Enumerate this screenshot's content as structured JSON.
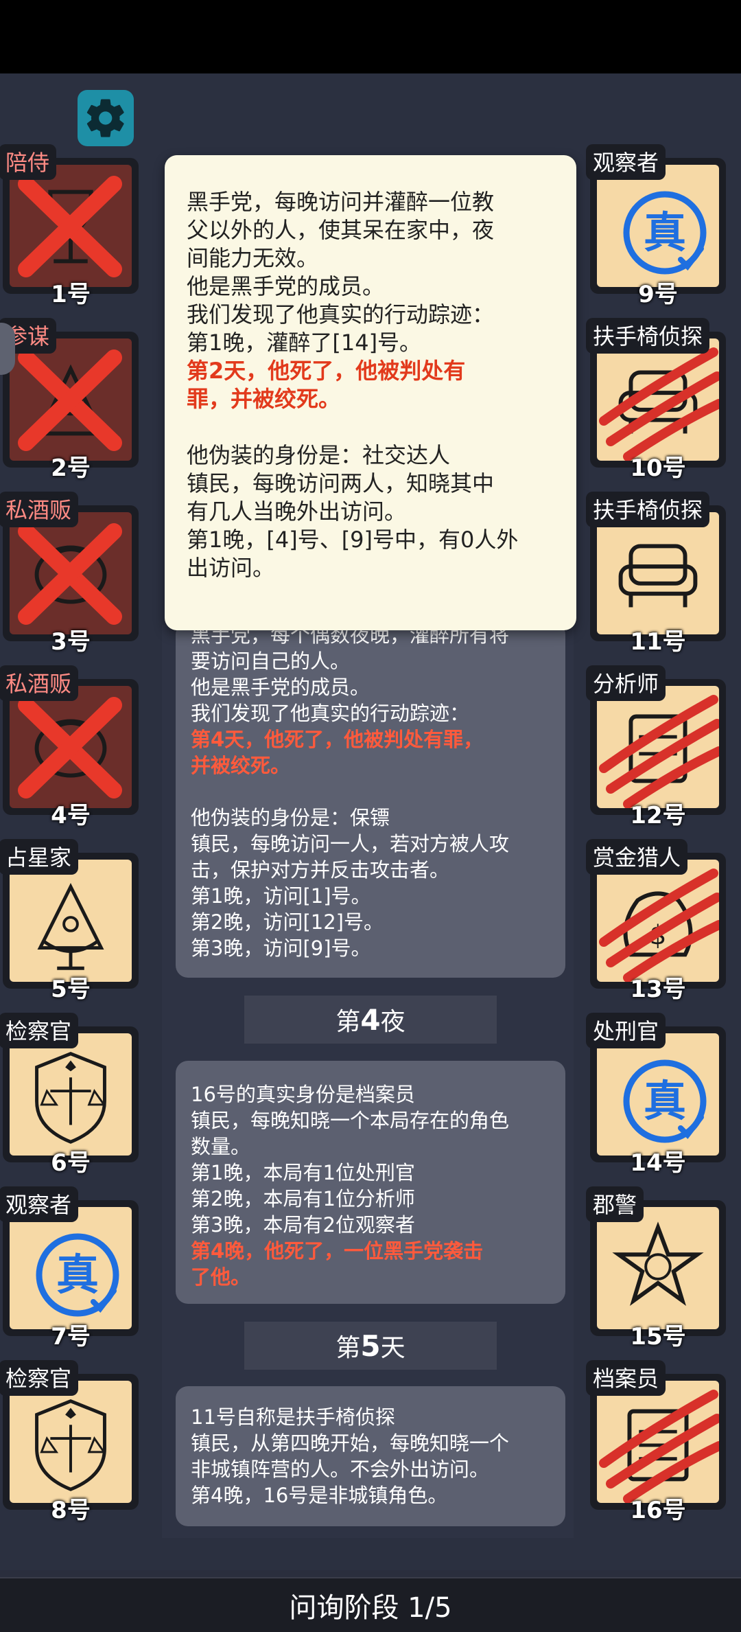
{
  "bottom": {
    "phase_label": "问询阶段 1/5"
  },
  "players_left": [
    {
      "role": "陪侍",
      "num": "1号",
      "state": "dead",
      "icon": "wine-glass-icon"
    },
    {
      "role": "参谋",
      "num": "2号",
      "state": "dead",
      "icon": "consigliere-icon"
    },
    {
      "role": "私酒贩",
      "num": "3号",
      "state": "dead",
      "icon": "bootlegger-icon"
    },
    {
      "role": "私酒贩",
      "num": "4号",
      "state": "dead",
      "icon": "bootlegger-icon"
    },
    {
      "role": "占星家",
      "num": "5号",
      "state": "alive",
      "icon": "sextant-icon"
    },
    {
      "role": "检察官",
      "num": "6号",
      "state": "alive",
      "icon": "justice-scales-icon"
    },
    {
      "role": "观察者",
      "num": "7号",
      "state": "verified",
      "icon": "true-stamp-icon"
    },
    {
      "role": "检察官",
      "num": "8号",
      "state": "alive",
      "icon": "justice-scales-icon"
    }
  ],
  "players_right": [
    {
      "role": "观察者",
      "num": "9号",
      "state": "verified",
      "icon": "true-stamp-icon"
    },
    {
      "role": "扶手椅侦探",
      "num": "10号",
      "state": "clawed",
      "icon": "armchair-icon"
    },
    {
      "role": "扶手椅侦探",
      "num": "11号",
      "state": "alive",
      "icon": "armchair-icon"
    },
    {
      "role": "分析师",
      "num": "12号",
      "state": "clawed",
      "icon": "analyst-icon"
    },
    {
      "role": "赏金猎人",
      "num": "13号",
      "state": "clawed",
      "icon": "money-bag-icon"
    },
    {
      "role": "处刑官",
      "num": "14号",
      "state": "verified",
      "icon": "true-stamp-icon"
    },
    {
      "role": "郡警",
      "num": "15号",
      "state": "alive",
      "icon": "sheriff-star-icon"
    },
    {
      "role": "档案员",
      "num": "16号",
      "state": "clawed",
      "icon": "archive-icon"
    }
  ],
  "popup": {
    "lines": [
      "黑手党，每晚访问并灌醉一位教",
      "父以外的人，使其呆在家中，夜",
      "间能力无效。",
      "他是黑手党的成员。",
      "我们发现了他真实的行动踪迹：",
      "第1晚，灌醉了[14]号。"
    ],
    "red_lines": [
      "第2天，他死了，他被判处有",
      "罪，并被绞死。"
    ],
    "disguise_lines": [
      "他伪装的身份是：社交达人",
      "镇民，每晚访问两人，知晓其中",
      "有几人当晚外出访问。",
      "第1晚，[4]号、[9]号中，有0人外",
      "出访问。"
    ]
  },
  "log": {
    "entry1": {
      "lines": [
        "黑手党，每个偶数夜晚，灌醉所有将",
        "要访问自己的人。",
        "他是黑手党的成员。",
        "我们发现了他真实的行动踪迹："
      ],
      "red_lines": [
        "第4天，他死了，他被判处有罪，",
        "并被绞死。"
      ],
      "disguise_lines": [
        "他伪装的身份是：保镖",
        "镇民，每晚访问一人，若对方被人攻",
        "击，保护对方并反击攻击者。",
        "第1晚，访问[1]号。",
        "第2晚，访问[12]号。",
        "第3晚，访问[9]号。"
      ]
    },
    "phase1": {
      "prefix": "第",
      "num": "4",
      "suffix": "夜"
    },
    "entry2": {
      "lines": [
        "16号的真实身份是档案员",
        "镇民，每晚知晓一个本局存在的角色",
        "数量。",
        "第1晚，本局有1位处刑官",
        "第2晚，本局有1位分析师",
        "第3晚，本局有2位观察者"
      ],
      "red_lines": [
        "第4晚，他死了，一位黑手党袭击",
        "了他。"
      ]
    },
    "phase2": {
      "prefix": "第",
      "num": "5",
      "suffix": "天"
    },
    "entry3": {
      "lines": [
        "11号自称是扶手椅侦探",
        "镇民，从第四晚开始，每晚知晓一个",
        "非城镇阵营的人。不会外出访问。",
        "第4晚，16号是非城镇角色。"
      ]
    }
  },
  "colors": {
    "dead_card": "#6b2e2a",
    "alive_card": "#f6d9a6",
    "x_mark": "#e8382a",
    "stamp_blue": "#1f6fe0",
    "red_text": "#ff5a3c"
  },
  "stamp_text": "真"
}
